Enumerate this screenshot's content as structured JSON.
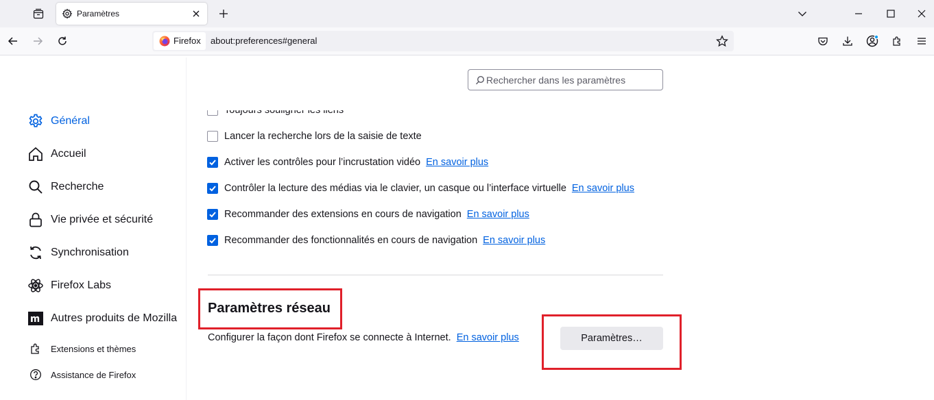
{
  "tabbar": {
    "tab_title": "Paramètres"
  },
  "navbar": {
    "identity_label": "Firefox",
    "url": "about:preferences#general"
  },
  "search": {
    "placeholder": "Rechercher dans les paramètres"
  },
  "sidebar": {
    "items": [
      {
        "label": "Général",
        "icon": "gear-icon",
        "active": true
      },
      {
        "label": "Accueil",
        "icon": "home-icon"
      },
      {
        "label": "Recherche",
        "icon": "search-icon"
      },
      {
        "label": "Vie privée et sécurité",
        "icon": "lock-icon"
      },
      {
        "label": "Synchronisation",
        "icon": "sync-icon"
      },
      {
        "label": "Firefox Labs",
        "icon": "atom-icon"
      },
      {
        "label": "Autres produits de Mozilla",
        "icon": "mozilla-icon"
      },
      {
        "label": "Extensions et thèmes",
        "icon": "puzzle-icon"
      },
      {
        "label": "Assistance de Firefox",
        "icon": "help-icon"
      }
    ]
  },
  "browsing": {
    "items": [
      {
        "label": "Toujours souligner les liens",
        "checked": false,
        "link": ""
      },
      {
        "label": "Lancer la recherche lors de la saisie de texte",
        "checked": false,
        "link": ""
      },
      {
        "label": "Activer les contrôles pour l’incrustation vidéo",
        "checked": true,
        "link": "En savoir plus"
      },
      {
        "label": "Contrôler la lecture des médias via le clavier, un casque ou l’interface virtuelle",
        "checked": true,
        "link": "En savoir plus"
      },
      {
        "label": "Recommander des extensions en cours de navigation",
        "checked": true,
        "link": "En savoir plus"
      },
      {
        "label": "Recommander des fonctionnalités en cours de navigation",
        "checked": true,
        "link": "En savoir plus"
      }
    ]
  },
  "network": {
    "title": "Paramètres réseau",
    "description": "Configurer la façon dont Firefox se connecte à Internet.",
    "link": "En savoir plus",
    "button_label": "Paramètres…"
  },
  "colors": {
    "accent": "#0061e0",
    "highlight": "#e0202a"
  }
}
